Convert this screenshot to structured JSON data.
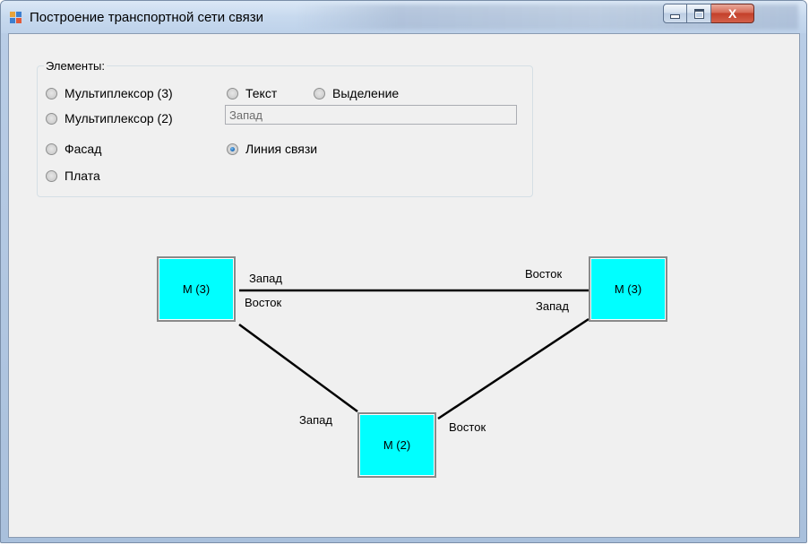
{
  "window": {
    "title": "Построение транспортной сети связи",
    "buttons": {
      "minimize_icon": "minimize-icon",
      "maximize_icon": "maximize-icon",
      "close": "X"
    }
  },
  "elements_group": {
    "legend": "Элементы:",
    "options": {
      "mux3": {
        "label": "Мультиплексор (3)",
        "checked": false
      },
      "text": {
        "label": "Текст",
        "checked": false
      },
      "selection": {
        "label": "Выделение",
        "checked": false
      },
      "mux2": {
        "label": "Мультиплексор (2)",
        "checked": false
      },
      "facade": {
        "label": "Фасад",
        "checked": false
      },
      "link": {
        "label": "Линия связи",
        "checked": true
      },
      "board": {
        "label": "Плата",
        "checked": false
      }
    },
    "text_input": {
      "value": "Запад"
    }
  },
  "diagram": {
    "nodes": {
      "left": {
        "label": "М (3)"
      },
      "right": {
        "label": "М (3)"
      },
      "bottom": {
        "label": "М (2)"
      }
    },
    "labels": {
      "top_left_upper": "Запад",
      "top_left_lower": "Восток",
      "top_right_upper": "Восток",
      "top_right_lower": "Запад",
      "bottom_left": "Запад",
      "bottom_right": "Восток"
    },
    "node_color": "#00ffff",
    "line_color": "#000000"
  }
}
